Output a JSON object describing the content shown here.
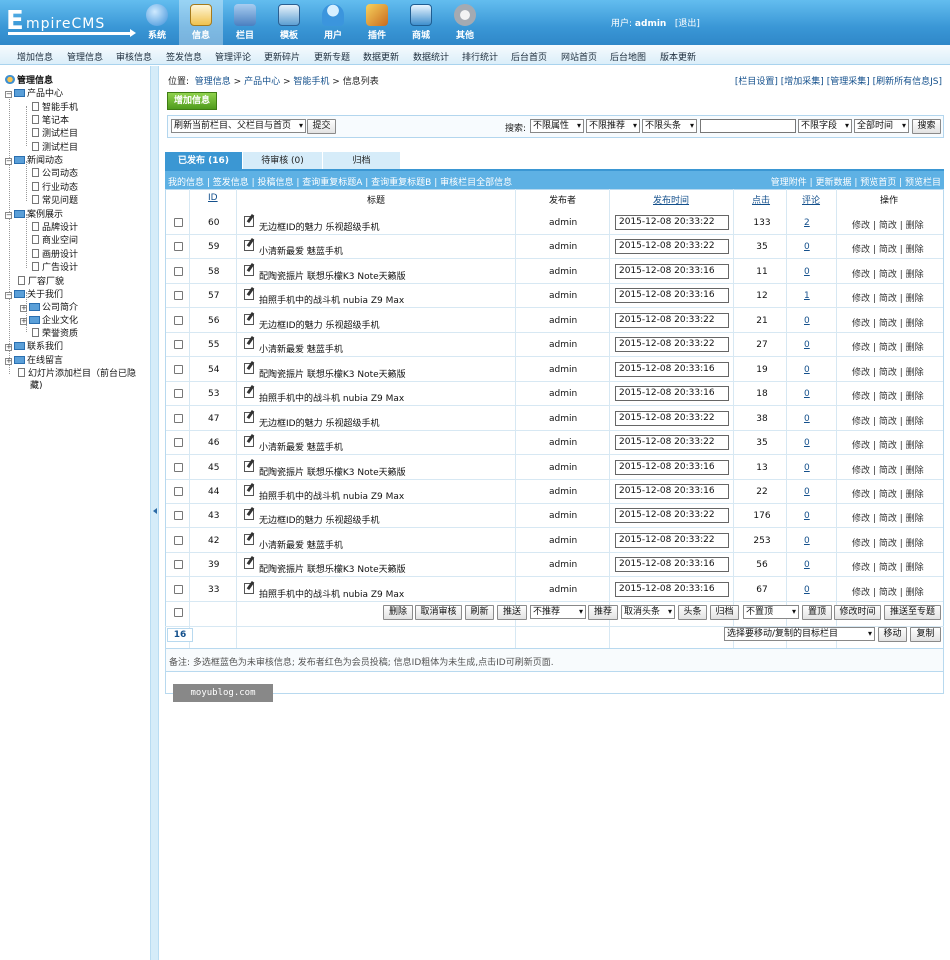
{
  "brand": {
    "logo_big": "E",
    "logo_rest": "mpireCMS"
  },
  "nav": [
    {
      "label": "系统",
      "icon": "globe-icon",
      "color": "#6fb7ee"
    },
    {
      "label": "信息",
      "icon": "edit-icon",
      "color": "#f0c24e"
    },
    {
      "label": "栏目",
      "icon": "folder-icon",
      "color": "#5e8fc8"
    },
    {
      "label": "模板",
      "icon": "template-icon",
      "color": "#5c9fd2"
    },
    {
      "label": "用户",
      "icon": "user-icon",
      "color": "#56a8e4"
    },
    {
      "label": "插件",
      "icon": "tools-icon",
      "color": "#e2963a"
    },
    {
      "label": "商城",
      "icon": "shop-icon",
      "color": "#3f8fcd"
    },
    {
      "label": "其他",
      "icon": "gear-icon",
      "color": "#b4b9c0"
    }
  ],
  "user": {
    "prefix": "用户:",
    "name": "admin",
    "logout": "[退出]"
  },
  "menu": [
    "增加信息",
    "管理信息",
    "审核信息",
    "签发信息",
    "管理评论",
    "更新碎片",
    "更新专题",
    "数据更新",
    "数据统计",
    "排行统计",
    "后台首页",
    "网站首页",
    "后台地图",
    "版本更新"
  ],
  "sidebar": {
    "title": "管理信息",
    "nodes": [
      "产品中心",
      "智能手机",
      "笔记本",
      "测试栏目",
      "测试栏目",
      "新闻动态",
      "公司动态",
      "行业动态",
      "常见问题",
      "案例展示",
      "品牌设计",
      "商业空间",
      "画册设计",
      "广告设计",
      "厂容厂貌",
      "关于我们",
      "公司简介",
      "企业文化",
      "荣誉资质",
      "联系我们",
      "在线留言",
      "幻灯片添加栏目（前台已隐",
      "藏)"
    ]
  },
  "breadcrumb": {
    "prefix": "位置:",
    "path1": "管理信息",
    "sep": ">",
    "path2": "产品中心",
    "path3": "智能手机",
    "path4": "信息列表"
  },
  "toplinks": [
    "[栏目设置]",
    "[增加采集]",
    "[管理采集]",
    "[刷新所有信息JS]"
  ],
  "add_button": "增加信息",
  "toolbar": {
    "refresh_select": "刷新当前栏目、父栏目与首页",
    "submit": "提交",
    "search_label": "搜索:",
    "f1": "不限属性",
    "f2": "不限推荐",
    "f3": "不限头条",
    "search_value": "",
    "f4": "不限字段",
    "f5": "全部时间",
    "search_btn": "搜索"
  },
  "tabs": [
    "已发布 (16)",
    "待审核 (0)",
    "归档"
  ],
  "links_left": "我的信息 | 签发信息 | 投稿信息 | 查询重复标题A | 查询重复标题B | 审核栏目全部信息",
  "links_right": "管理附件 | 更新数据 | 预览首页 | 预览栏目",
  "headers": {
    "id": "ID",
    "title": "标题",
    "author": "发布者",
    "time": "发布时间",
    "clicks": "点击",
    "comments": "评论",
    "ops": "操作"
  },
  "op_labels": {
    "edit": "修改",
    "quick": "简改",
    "del": "删除",
    "sep": "|"
  },
  "rows": [
    {
      "id": "60",
      "title": "无边框ID的魅力 乐视超级手机",
      "author": "admin",
      "time": "2015-12-08 20:33:22",
      "clicks": "133",
      "comments": "2"
    },
    {
      "id": "59",
      "title": "小清新最爱 魅蓝手机",
      "author": "admin",
      "time": "2015-12-08 20:33:22",
      "clicks": "35",
      "comments": "0"
    },
    {
      "id": "58",
      "title": "配陶瓷振片 联想乐檬K3 Note天籁版",
      "author": "admin",
      "time": "2015-12-08 20:33:16",
      "clicks": "11",
      "comments": "0"
    },
    {
      "id": "57",
      "title": "拍照手机中的战斗机 nubia Z9 Max",
      "author": "admin",
      "time": "2015-12-08 20:33:16",
      "clicks": "12",
      "comments": "1"
    },
    {
      "id": "56",
      "title": "无边框ID的魅力 乐视超级手机",
      "author": "admin",
      "time": "2015-12-08 20:33:22",
      "clicks": "21",
      "comments": "0"
    },
    {
      "id": "55",
      "title": "小清新最爱 魅蓝手机",
      "author": "admin",
      "time": "2015-12-08 20:33:22",
      "clicks": "27",
      "comments": "0"
    },
    {
      "id": "54",
      "title": "配陶瓷振片 联想乐檬K3 Note天籁版",
      "author": "admin",
      "time": "2015-12-08 20:33:16",
      "clicks": "19",
      "comments": "0"
    },
    {
      "id": "53",
      "title": "拍照手机中的战斗机 nubia Z9 Max",
      "author": "admin",
      "time": "2015-12-08 20:33:16",
      "clicks": "18",
      "comments": "0"
    },
    {
      "id": "47",
      "title": "无边框ID的魅力 乐视超级手机",
      "author": "admin",
      "time": "2015-12-08 20:33:22",
      "clicks": "38",
      "comments": "0"
    },
    {
      "id": "46",
      "title": "小清新最爱 魅蓝手机",
      "author": "admin",
      "time": "2015-12-08 20:33:22",
      "clicks": "35",
      "comments": "0"
    },
    {
      "id": "45",
      "title": "配陶瓷振片 联想乐檬K3 Note天籁版",
      "author": "admin",
      "time": "2015-12-08 20:33:16",
      "clicks": "13",
      "comments": "0"
    },
    {
      "id": "44",
      "title": "拍照手机中的战斗机 nubia Z9 Max",
      "author": "admin",
      "time": "2015-12-08 20:33:16",
      "clicks": "22",
      "comments": "0"
    },
    {
      "id": "43",
      "title": "无边框ID的魅力 乐视超级手机",
      "author": "admin",
      "time": "2015-12-08 20:33:22",
      "clicks": "176",
      "comments": "0"
    },
    {
      "id": "42",
      "title": "小清新最爱 魅蓝手机",
      "author": "admin",
      "time": "2015-12-08 20:33:22",
      "clicks": "253",
      "comments": "0"
    },
    {
      "id": "39",
      "title": "配陶瓷振片 联想乐檬K3 Note天籁版",
      "author": "admin",
      "time": "2015-12-08 20:33:16",
      "clicks": "56",
      "comments": "0"
    },
    {
      "id": "33",
      "title": "拍照手机中的战斗机 nubia Z9 Max",
      "author": "admin",
      "time": "2015-12-08 20:33:16",
      "clicks": "67",
      "comments": "0"
    }
  ],
  "bulk": {
    "delete": "删除",
    "unaudit": "取消审核",
    "refresh": "刷新",
    "push": "推送",
    "not_recommend": "不推荐",
    "recommend": "推荐",
    "cancel_headline": "取消头条",
    "headline": "头条",
    "archive": "归档",
    "not_top": "不置顶",
    "top": "置顶",
    "modify_time": "修改时间",
    "push_topic": "推送至专题"
  },
  "pager": {
    "count": "16",
    "move_select": "选择要移动/复制的目标栏目",
    "move": "移动",
    "copy": "复制"
  },
  "note": "备注: 多选框蓝色为未审核信息; 发布者红色为会员投稿; 信息ID粗体为未生成,点击ID可刷新页面.",
  "watermark": "moyublog.com"
}
